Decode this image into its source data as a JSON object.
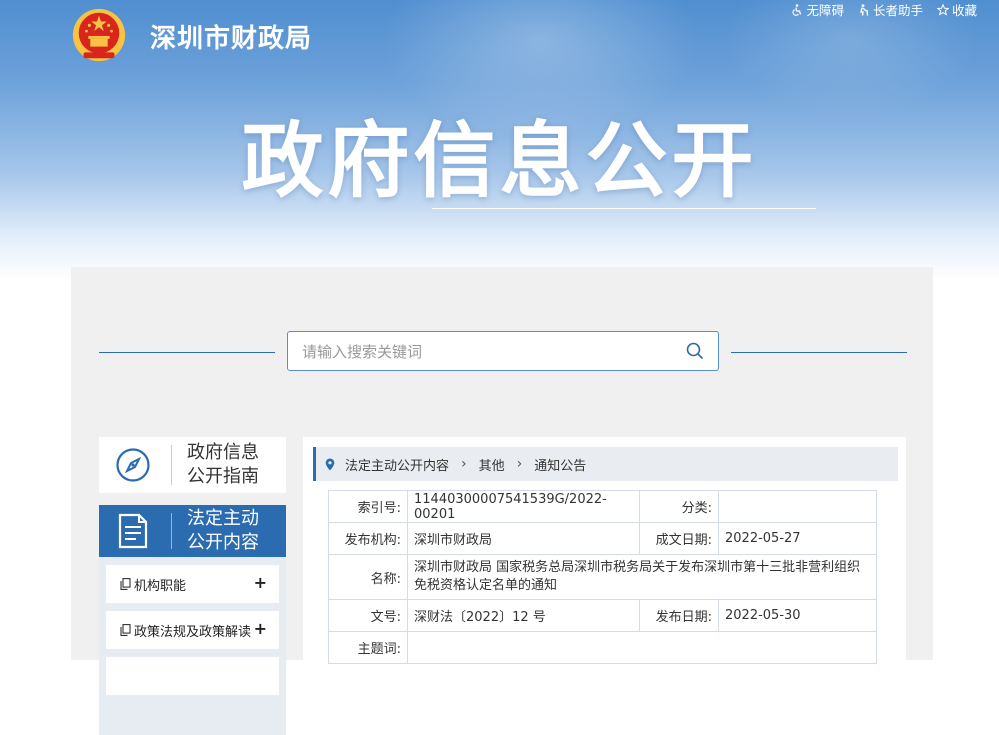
{
  "header": {
    "site_name": "深圳市财政局",
    "toplinks": {
      "accessible": "无障碍",
      "elder_helper": "长者助手",
      "favorite": "收藏"
    },
    "banner_title": "政府信息公开"
  },
  "search": {
    "placeholder": "请输入搜索关键词"
  },
  "sidebar": {
    "guide_line1": "政府信息",
    "guide_line2": "公开指南",
    "active_line1": "法定主动",
    "active_line2": "公开内容",
    "items": [
      {
        "label": "机构职能",
        "expander": "+"
      },
      {
        "label": "政策法规及政策解读",
        "expander": "+"
      }
    ]
  },
  "breadcrumb": [
    "法定主动公开内容",
    "其他",
    "通知公告"
  ],
  "breadcrumb_sep": "›",
  "info": {
    "index_label": "索引号:",
    "index_value": "11440300007541539G/2022-00201",
    "category_label": "分类:",
    "category_value": "",
    "publisher_label": "发布机构:",
    "publisher_value": "深圳市财政局",
    "created_label": "成文日期:",
    "created_value": "2022-05-27",
    "name_label": "名称:",
    "name_value": "深圳市财政局 国家税务总局深圳市税务局关于发布深圳市第十三批非营利组织免税资格认定名单的通知",
    "docno_label": "文号:",
    "docno_value": "深财法〔2022〕12 号",
    "pubdate_label": "发布日期:",
    "pubdate_value": "2022-05-30",
    "subject_label": "主题词:",
    "subject_value": ""
  },
  "colors": {
    "primary": "#2b6cb0",
    "banner_top": "#4f8ed0",
    "panel_bg": "#f0f0f0",
    "emblem_red": "#d8261e",
    "emblem_gold": "#f6c343"
  },
  "icons": [
    "national-emblem-icon",
    "wheelchair-icon",
    "elder-icon",
    "star-icon",
    "search-icon",
    "compass-icon",
    "document-icon",
    "page-icon",
    "location-pin-icon"
  ]
}
